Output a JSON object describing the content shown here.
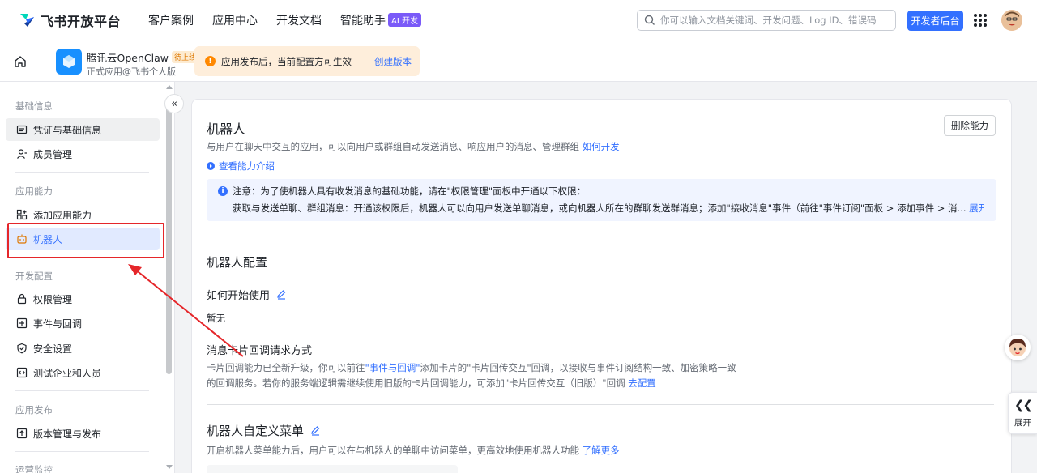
{
  "brand": {
    "name": "飞书开放平台",
    "primary_color": "#3370ff"
  },
  "nav": [
    {
      "label": "客户案例"
    },
    {
      "label": "应用中心"
    },
    {
      "label": "开发文档"
    },
    {
      "label": "智能助手",
      "badge": "AI 开发"
    }
  ],
  "search": {
    "placeholder": "你可以输入文档关键词、开发问题、Log ID、错误码"
  },
  "header_actions": {
    "dev_console_label": "开发者后台"
  },
  "app": {
    "name": "腾讯云OpenClaw",
    "status": "待上线",
    "subtitle": "正式应用@飞书个人版"
  },
  "notice": {
    "text": "应用发布后，当前配置方可生效",
    "action": "创建版本"
  },
  "sidebar": {
    "groups": [
      {
        "title": "基础信息",
        "items": [
          {
            "label": "凭证与基础信息",
            "icon": "credential-icon"
          },
          {
            "label": "成员管理",
            "icon": "member-icon"
          }
        ]
      },
      {
        "title": "应用能力",
        "items": [
          {
            "label": "添加应用能力",
            "icon": "add-capability-icon"
          },
          {
            "label": "机器人",
            "icon": "robot-icon",
            "active": true
          }
        ]
      },
      {
        "title": "开发配置",
        "items": [
          {
            "label": "权限管理",
            "icon": "lock-icon"
          },
          {
            "label": "事件与回调",
            "icon": "event-icon"
          },
          {
            "label": "安全设置",
            "icon": "shield-icon"
          },
          {
            "label": "测试企业和人员",
            "icon": "code-icon"
          }
        ]
      },
      {
        "title": "应用发布",
        "items": [
          {
            "label": "版本管理与发布",
            "icon": "upload-icon"
          }
        ]
      },
      {
        "title": "运营监控",
        "items": []
      }
    ]
  },
  "main": {
    "title": "机器人",
    "desc_prefix": "与用户在聊天中交互的应用，可以向用户或群组自动发送消息、响应用户的消息、管理群组",
    "desc_link": "如何开发",
    "view_intro": "查看能力介绍",
    "remove_button": "删除能力",
    "info": {
      "line1": "注意：为了使机器人具有收发消息的基础功能，请在\"权限管理\"面板中开通以下权限：",
      "line2": "获取与发送单聊、群组消息：开通该权限后，机器人可以向用户发送单聊消息，或向机器人所在的群聊发送群消息；添加\"接收消息\"事件（前往\"事件订阅\"面板 > 添加事件 > 消...",
      "more_link": "展开详情"
    },
    "config_title": "机器人配置",
    "how_to_start": {
      "title": "如何开始使用",
      "value": "暂无"
    },
    "card_callback": {
      "title": "消息卡片回调请求方式",
      "line1_prefix": "卡片回调能力已全新升级，你可以前往",
      "line1_link": "\"事件与回调\"",
      "line1_suffix": "添加卡片的\"卡片回传交互\"回调，以接收与事件订阅结构一致、加密策略一致",
      "line2_prefix": "的回调服务。若你的服务端逻辑需继续使用旧版的卡片回调能力，可添加\"卡片回传交互（旧版）\"回调",
      "line2_link": "去配置"
    },
    "custom_menu": {
      "title": "机器人自定义菜单",
      "desc_prefix": "开启机器人菜单能力后，用户可以在与机器人的单聊中访问菜单，更高效地使用机器人功能",
      "desc_link": "了解更多"
    }
  },
  "right_panel": {
    "expand_label": "展开"
  },
  "annotation": {
    "highlight_color": "#e5262a"
  }
}
